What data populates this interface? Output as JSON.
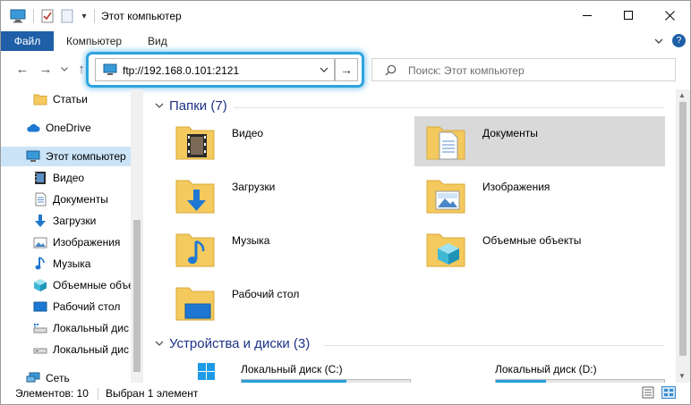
{
  "window": {
    "title": "Этот компьютер",
    "controls": {
      "minimize": "—",
      "maximize": "☐",
      "close": "✕"
    }
  },
  "ribbon": {
    "file": "Файл",
    "tabs": [
      "Компьютер",
      "Вид"
    ],
    "expand": "⌄",
    "help": "?"
  },
  "nav": {
    "back": "←",
    "forward": "→",
    "recent": "⌄",
    "up": "↑",
    "address": "ftp://192.168.0.101:2121",
    "address_dropdown": "⌄",
    "go": "→",
    "search_placeholder": "Поиск: Этот компьютер"
  },
  "sidebar": {
    "items": [
      {
        "label": "Статьи",
        "icon": "folder-icon"
      },
      {
        "label": "OneDrive",
        "icon": "cloud-icon"
      },
      {
        "label": "Этот компьютер",
        "icon": "computer-icon",
        "selected": true
      },
      {
        "label": "Видео",
        "icon": "video-icon"
      },
      {
        "label": "Документы",
        "icon": "document-icon"
      },
      {
        "label": "Загрузки",
        "icon": "download-icon"
      },
      {
        "label": "Изображения",
        "icon": "image-icon"
      },
      {
        "label": "Музыка",
        "icon": "music-icon"
      },
      {
        "label": "Объемные объе",
        "icon": "cube-icon"
      },
      {
        "label": "Рабочий стол",
        "icon": "desktop-icon"
      },
      {
        "label": "Локальный дис",
        "icon": "drive-icon"
      },
      {
        "label": "Локальный дис",
        "icon": "drive-icon"
      },
      {
        "label": "Сеть",
        "icon": "network-icon"
      }
    ]
  },
  "content": {
    "folders_header": "Папки (7)",
    "folders": [
      {
        "label": "Видео",
        "icon": "video-folder-icon"
      },
      {
        "label": "Документы",
        "icon": "documents-folder-icon",
        "selected": true
      },
      {
        "label": "Загрузки",
        "icon": "downloads-folder-icon"
      },
      {
        "label": "Изображения",
        "icon": "pictures-folder-icon"
      },
      {
        "label": "Музыка",
        "icon": "music-folder-icon"
      },
      {
        "label": "Объемные объекты",
        "icon": "3d-objects-folder-icon"
      },
      {
        "label": "Рабочий стол",
        "icon": "desktop-folder-icon"
      }
    ],
    "drives_header": "Устройства и диски (3)",
    "drives": [
      {
        "label": "Локальный диск (C:)",
        "used_fraction": 0.62
      },
      {
        "label": "Локальный диск (D:)",
        "used_fraction": 0.3
      }
    ]
  },
  "status": {
    "items_count": "Элементов: 10",
    "selected": "Выбран 1 элемент"
  },
  "colors": {
    "accent": "#1f5fa8",
    "highlight_ring": "#2fa4e0",
    "selection": "#cce4f7",
    "folder": "#f4c95d",
    "drive_fill": "#26a0da"
  }
}
